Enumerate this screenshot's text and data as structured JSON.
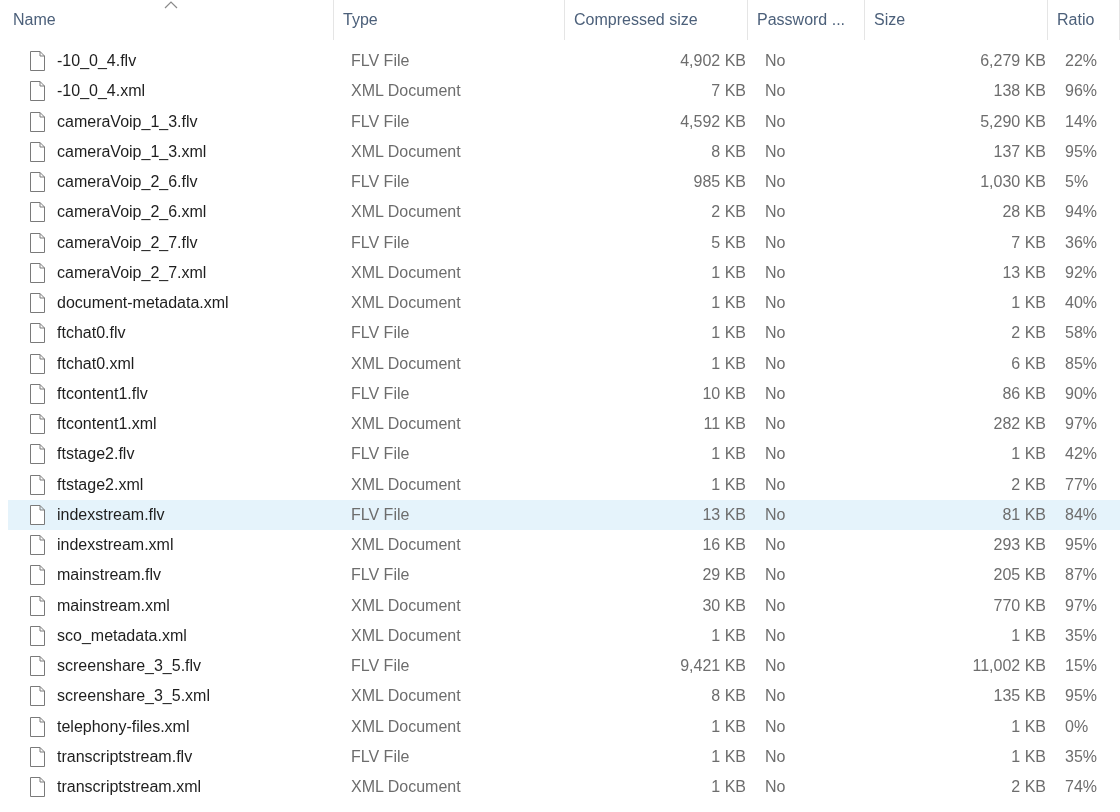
{
  "columns": [
    {
      "label": "Name",
      "sorted": true
    },
    {
      "label": "Type",
      "sorted": false
    },
    {
      "label": "Compressed size",
      "sorted": false
    },
    {
      "label": "Password ...",
      "sorted": false
    },
    {
      "label": "Size",
      "sorted": false
    },
    {
      "label": "Ratio",
      "sorted": false
    }
  ],
  "rows": [
    {
      "name": "-10_0_4.flv",
      "type": "FLV File",
      "compressed_size": "4,902 KB",
      "password": "No",
      "size": "6,279 KB",
      "ratio": "22%",
      "selected": false
    },
    {
      "name": "-10_0_4.xml",
      "type": "XML Document",
      "compressed_size": "7 KB",
      "password": "No",
      "size": "138 KB",
      "ratio": "96%",
      "selected": false
    },
    {
      "name": "cameraVoip_1_3.flv",
      "type": "FLV File",
      "compressed_size": "4,592 KB",
      "password": "No",
      "size": "5,290 KB",
      "ratio": "14%",
      "selected": false
    },
    {
      "name": "cameraVoip_1_3.xml",
      "type": "XML Document",
      "compressed_size": "8 KB",
      "password": "No",
      "size": "137 KB",
      "ratio": "95%",
      "selected": false
    },
    {
      "name": "cameraVoip_2_6.flv",
      "type": "FLV File",
      "compressed_size": "985 KB",
      "password": "No",
      "size": "1,030 KB",
      "ratio": "5%",
      "selected": false
    },
    {
      "name": "cameraVoip_2_6.xml",
      "type": "XML Document",
      "compressed_size": "2 KB",
      "password": "No",
      "size": "28 KB",
      "ratio": "94%",
      "selected": false
    },
    {
      "name": "cameraVoip_2_7.flv",
      "type": "FLV File",
      "compressed_size": "5 KB",
      "password": "No",
      "size": "7 KB",
      "ratio": "36%",
      "selected": false
    },
    {
      "name": "cameraVoip_2_7.xml",
      "type": "XML Document",
      "compressed_size": "1 KB",
      "password": "No",
      "size": "13 KB",
      "ratio": "92%",
      "selected": false
    },
    {
      "name": "document-metadata.xml",
      "type": "XML Document",
      "compressed_size": "1 KB",
      "password": "No",
      "size": "1 KB",
      "ratio": "40%",
      "selected": false
    },
    {
      "name": "ftchat0.flv",
      "type": "FLV File",
      "compressed_size": "1 KB",
      "password": "No",
      "size": "2 KB",
      "ratio": "58%",
      "selected": false
    },
    {
      "name": "ftchat0.xml",
      "type": "XML Document",
      "compressed_size": "1 KB",
      "password": "No",
      "size": "6 KB",
      "ratio": "85%",
      "selected": false
    },
    {
      "name": "ftcontent1.flv",
      "type": "FLV File",
      "compressed_size": "10 KB",
      "password": "No",
      "size": "86 KB",
      "ratio": "90%",
      "selected": false
    },
    {
      "name": "ftcontent1.xml",
      "type": "XML Document",
      "compressed_size": "11 KB",
      "password": "No",
      "size": "282 KB",
      "ratio": "97%",
      "selected": false
    },
    {
      "name": "ftstage2.flv",
      "type": "FLV File",
      "compressed_size": "1 KB",
      "password": "No",
      "size": "1 KB",
      "ratio": "42%",
      "selected": false
    },
    {
      "name": "ftstage2.xml",
      "type": "XML Document",
      "compressed_size": "1 KB",
      "password": "No",
      "size": "2 KB",
      "ratio": "77%",
      "selected": false
    },
    {
      "name": "indexstream.flv",
      "type": "FLV File",
      "compressed_size": "13 KB",
      "password": "No",
      "size": "81 KB",
      "ratio": "84%",
      "selected": true
    },
    {
      "name": "indexstream.xml",
      "type": "XML Document",
      "compressed_size": "16 KB",
      "password": "No",
      "size": "293 KB",
      "ratio": "95%",
      "selected": false
    },
    {
      "name": "mainstream.flv",
      "type": "FLV File",
      "compressed_size": "29 KB",
      "password": "No",
      "size": "205 KB",
      "ratio": "87%",
      "selected": false
    },
    {
      "name": "mainstream.xml",
      "type": "XML Document",
      "compressed_size": "30 KB",
      "password": "No",
      "size": "770 KB",
      "ratio": "97%",
      "selected": false
    },
    {
      "name": "sco_metadata.xml",
      "type": "XML Document",
      "compressed_size": "1 KB",
      "password": "No",
      "size": "1 KB",
      "ratio": "35%",
      "selected": false
    },
    {
      "name": "screenshare_3_5.flv",
      "type": "FLV File",
      "compressed_size": "9,421 KB",
      "password": "No",
      "size": "11,002 KB",
      "ratio": "15%",
      "selected": false
    },
    {
      "name": "screenshare_3_5.xml",
      "type": "XML Document",
      "compressed_size": "8 KB",
      "password": "No",
      "size": "135 KB",
      "ratio": "95%",
      "selected": false
    },
    {
      "name": "telephony-files.xml",
      "type": "XML Document",
      "compressed_size": "1 KB",
      "password": "No",
      "size": "1 KB",
      "ratio": "0%",
      "selected": false
    },
    {
      "name": "transcriptstream.flv",
      "type": "FLV File",
      "compressed_size": "1 KB",
      "password": "No",
      "size": "1 KB",
      "ratio": "35%",
      "selected": false
    },
    {
      "name": "transcriptstream.xml",
      "type": "XML Document",
      "compressed_size": "1 KB",
      "password": "No",
      "size": "2 KB",
      "ratio": "74%",
      "selected": false
    }
  ]
}
